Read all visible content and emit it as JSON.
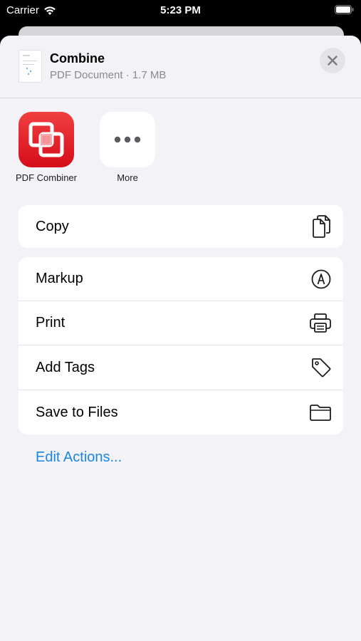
{
  "status_bar": {
    "carrier": "Carrier",
    "time": "5:23 PM"
  },
  "document": {
    "title": "Combine",
    "subtitle": "PDF Document · 1.7 MB"
  },
  "apps": [
    {
      "label": "PDF Combiner",
      "icon": "pdf-combiner-icon"
    },
    {
      "label": "More",
      "icon": "more-dots-icon"
    }
  ],
  "actions_group1": [
    {
      "label": "Copy",
      "icon": "copy-icon"
    }
  ],
  "actions_group2": [
    {
      "label": "Markup",
      "icon": "markup-icon"
    },
    {
      "label": "Print",
      "icon": "printer-icon"
    },
    {
      "label": "Add Tags",
      "icon": "tag-icon"
    },
    {
      "label": "Save to Files",
      "icon": "folder-icon"
    }
  ],
  "edit_actions": "Edit Actions...",
  "colors": {
    "accent": "#1a86e6",
    "sheet_bg": "#f2f2f7",
    "app_red": "#e01f2b"
  }
}
